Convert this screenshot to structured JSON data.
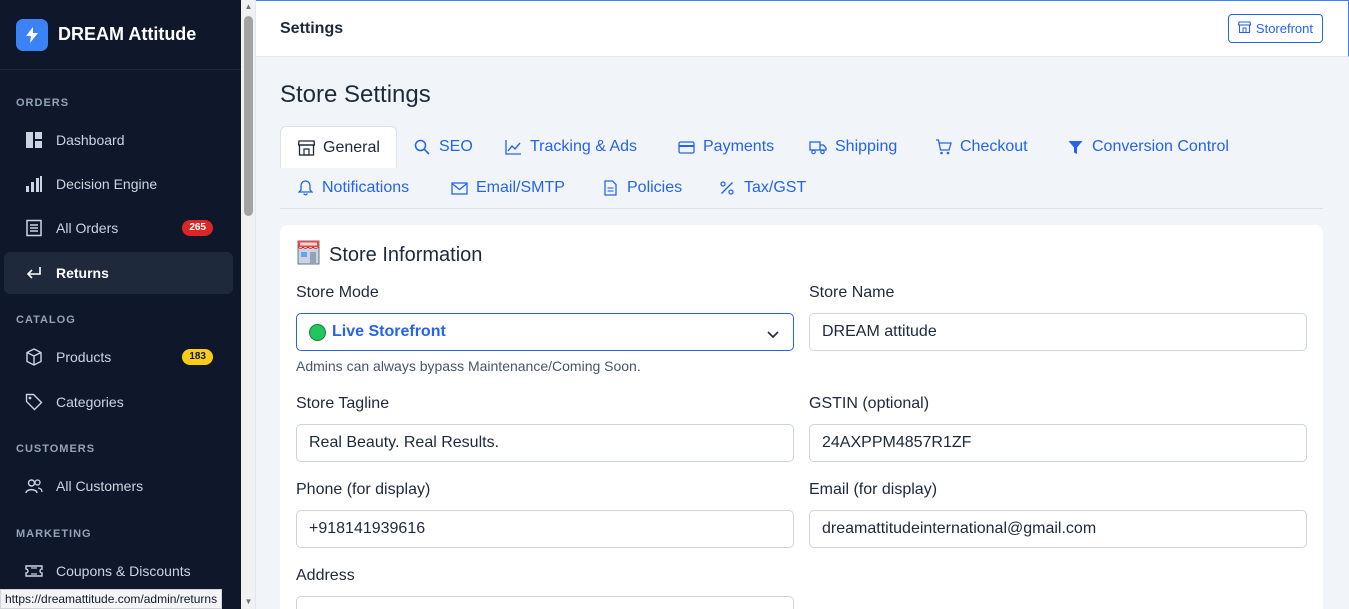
{
  "brand": {
    "name": "DREAM Attitude"
  },
  "sidebar": {
    "sections": [
      {
        "label": "ORDERS"
      },
      {
        "label": "CATALOG"
      },
      {
        "label": "CUSTOMERS"
      },
      {
        "label": "MARKETING"
      }
    ],
    "items": [
      {
        "label": "Dashboard",
        "icon": "dashboard-icon"
      },
      {
        "label": "Decision Engine",
        "icon": "bar-chart-icon"
      },
      {
        "label": "All Orders",
        "icon": "list-icon",
        "badge": "265"
      },
      {
        "label": "Returns",
        "icon": "return-arrow-icon",
        "active": true
      },
      {
        "label": "Products",
        "icon": "box-icon",
        "badge": "183"
      },
      {
        "label": "Categories",
        "icon": "tag-icon"
      },
      {
        "label": "All Customers",
        "icon": "users-icon"
      },
      {
        "label": "Coupons & Discounts",
        "icon": "ticket-icon"
      }
    ]
  },
  "status_bar": {
    "url": "https://dreamattitude.com/admin/returns"
  },
  "topbar": {
    "title": "Settings",
    "storefront_label": "Storefront"
  },
  "page": {
    "title": "Store Settings"
  },
  "tabs": [
    {
      "label": "General",
      "icon": "store-icon",
      "active": true
    },
    {
      "label": "SEO",
      "icon": "search-icon"
    },
    {
      "label": "Tracking & Ads",
      "icon": "trend-icon"
    },
    {
      "label": "Payments",
      "icon": "card-icon"
    },
    {
      "label": "Shipping",
      "icon": "truck-icon"
    },
    {
      "label": "Checkout",
      "icon": "cart-icon"
    },
    {
      "label": "Conversion Control",
      "icon": "funnel-icon"
    },
    {
      "label": "Notifications",
      "icon": "bell-icon"
    },
    {
      "label": "Email/SMTP",
      "icon": "envelope-icon"
    },
    {
      "label": "Policies",
      "icon": "document-icon"
    },
    {
      "label": "Tax/GST",
      "icon": "percent-icon"
    }
  ],
  "card": {
    "title": "Store Information",
    "title_icon": "store-emoji-icon",
    "fields": {
      "store_mode": {
        "label": "Store Mode",
        "value": "Live Storefront",
        "hint": "Admins can always bypass Maintenance/Coming Soon."
      },
      "store_name": {
        "label": "Store Name",
        "value": "DREAM attitude"
      },
      "store_tagline": {
        "label": "Store Tagline",
        "value": "Real Beauty. Real Results."
      },
      "gstin": {
        "label": "GSTIN (optional)",
        "value": "24AXPPM4857R1ZF"
      },
      "phone": {
        "label": "Phone (for display)",
        "value": "+918141939616"
      },
      "email": {
        "label": "Email (for display)",
        "value": "dreamattitudeinternational@gmail.com"
      },
      "address": {
        "label": "Address",
        "value": ""
      }
    }
  },
  "colors": {
    "accent": "#2563eb",
    "sidebar_bg": "#0f172a",
    "badge_red": "#dc2626",
    "badge_yellow": "#facc15"
  }
}
